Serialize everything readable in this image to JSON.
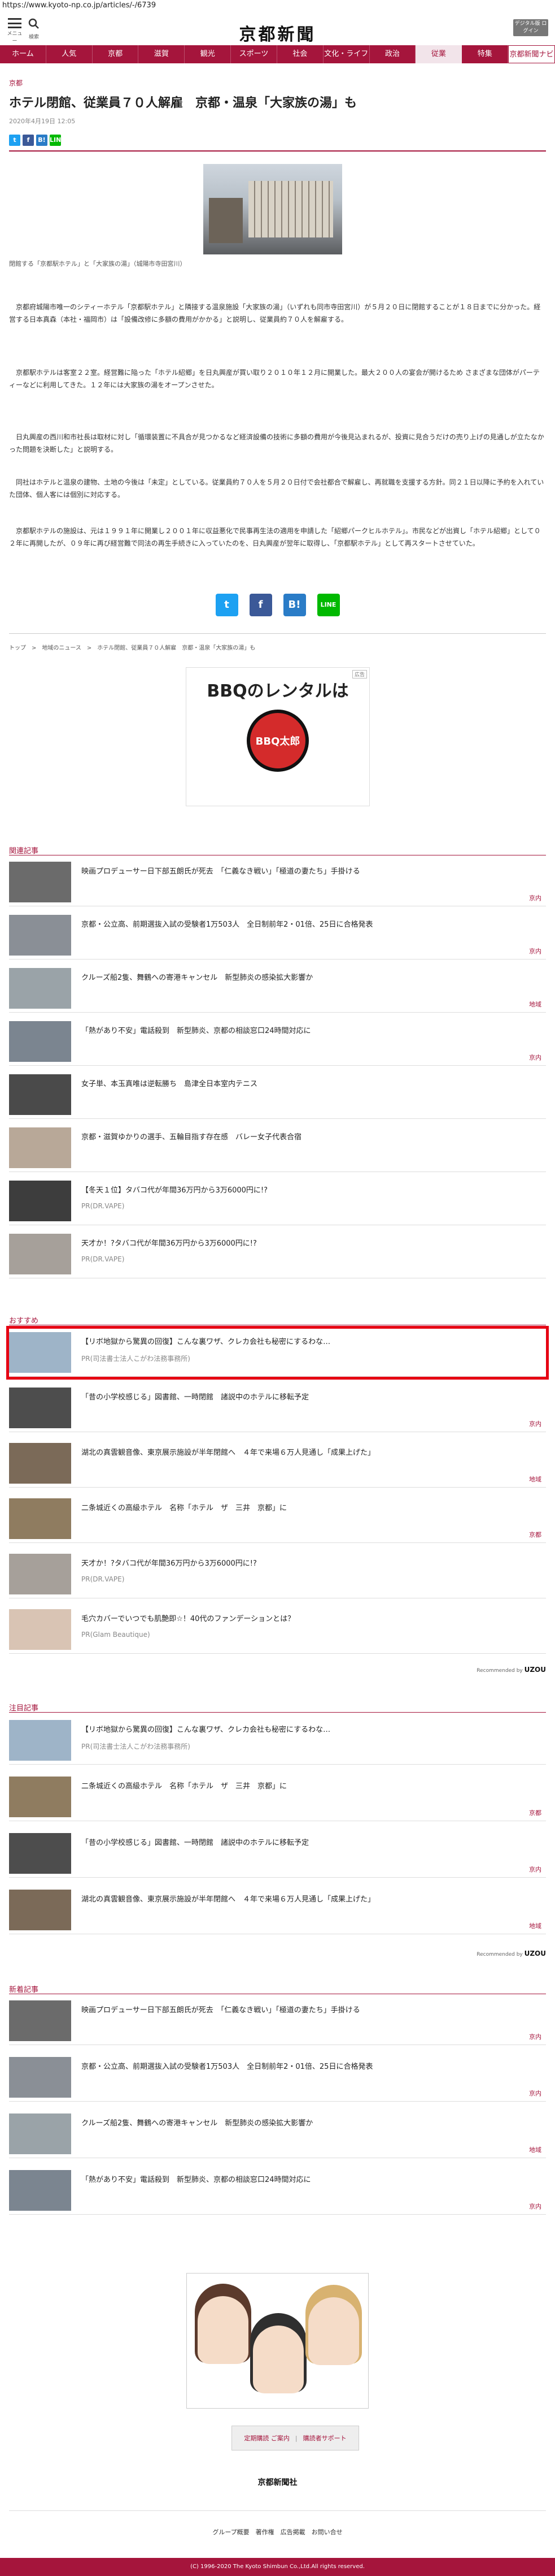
{
  "url": "https://www.kyoto-np.co.jp/articles/-/6739",
  "header": {
    "menu_label": "メニュー",
    "search_label": "検索",
    "logo": "京都新聞",
    "digital_label": "デジタル版\nログイン"
  },
  "nav": [
    "ホーム",
    "人気",
    "京都",
    "滋賀",
    "観光",
    "スポーツ",
    "社会",
    "文化・ライフ",
    "政治",
    "従業",
    "特集",
    "京都新聞ナビ"
  ],
  "article": {
    "section": "京都",
    "title": "ホテル閉館、従業員７０人解雇　京都・温泉「大家族の湯」も",
    "date": "2020年4月19日 12:05",
    "caption": "閉館する「京都駅ホテル」と「大家族の湯」（城陽市寺田宮川）",
    "paragraphs": [
      "京都府城陽市唯一のシティーホテル「京都駅ホテル」と隣接する温泉施設「大家族の湯」（いずれも同市寺田宮川）が５月２０日に閉館することが１８日までに分かった。経営する日本真森（本社・福岡市）は「設備改修に多額の費用がかかる」と説明し、従業員約７０人を解雇する。",
      "京都駅ホテルは客室２２室。経営難に陥った「ホテル紹郷」を日丸興産が買い取り２０１０年１２月に開業した。最大２００人の宴会が開けるため さまざまな団体がパーティーなどに利用してきた。１２年には大家族の湯をオープンさせた。",
      "日丸興産の西川和市社長は取材に対し「循環装置に不具合が見つかるなど経済設備の技術に多額の費用が今後見込まれるが、投資に見合うだけの売り上げの見通しが立たなかった問題を決断した」と説明する。",
      "同社はホテルと温泉の建物、土地の今後は「未定」としている。従業員約７０人を５月２０日付で会社都合で解雇し、再就職を支援する方針。同２１日以降に予約を入れていた団体、個人客には個別に対応する。",
      "京都駅ホテルの施設は、元は１９９１年に開業し２００１年に収益悪化で民事再生法の適用を申請した「紹郷パークヒルホテル」。市民などが出資し「ホテル紹郷」として０２年に再開したが、０９年に再び経営難で同法の再生手続きに入っていたのを、日丸興産が翌年に取得し、「京都駅ホテル」として再スタートさせていた。"
    ],
    "breadcrumb": "トップ　>　地域のニュース　>　ホテル閉館、従業員７０人解雇　京都・温泉「大家族の湯」も"
  },
  "share": {
    "tw": "t",
    "fb": "f",
    "hb": "B!",
    "line": "LINE"
  },
  "ad": {
    "tag": "広告",
    "title": "BBQのレンタルは",
    "brand": "BBQ太郎"
  },
  "related": {
    "title": "関連記事",
    "items": [
      {
        "text": "映画プロデューサー日下部五朗氏が死去　「仁義なき戦い」「極道の妻たち」手掛ける",
        "cat": "京内"
      },
      {
        "text": "京都・公立高、前期選抜入試の受験者1万503人　全日制前年2・01倍、25日に合格発表",
        "cat": "京内"
      },
      {
        "text": "クルーズ船2隻、舞鶴への寄港キャンセル　新型肺炎の感染拡大影響か",
        "cat": "地域"
      },
      {
        "text": "「熱があり不安」電話殺到　新型肺炎、京都の相談窓口24時間対応に",
        "cat": "京内"
      },
      {
        "text": "女子単、本玉真唯は逆転勝ち　島津全日本室内テニス",
        "cat": ""
      },
      {
        "text": "京都・滋賀ゆかりの選手、五輪目指す存在感　バレー女子代表合宿",
        "cat": ""
      },
      {
        "text": "【冬天１位】タバコ代が年間36万円から3万6000円に!?",
        "pr": "PR(DR.VAPE)",
        "cat": ""
      },
      {
        "text": "天才か！?タバコ代が年間36万円から3万6000円に!?",
        "pr": "PR(DR.VAPE)",
        "cat": ""
      }
    ]
  },
  "recommend": {
    "title": "おすすめ",
    "recommended_by": "Recommended by",
    "brand": "UZOU",
    "items": [
      {
        "text": "【リボ地獄から驚異の回復】こんな裏ワザ、クレカ会社も秘密にするわな…",
        "pr": "PR(司法書士法人こがわ法務事務所)",
        "cat": ""
      },
      {
        "text": "「昔の小学校感じる」図書館、一時閉館　諸説中のホテルに移転予定",
        "cat": "京内"
      },
      {
        "text": "湖北の真雲観音像、東京展示施設が半年閉館へ　４年で来場６万人見通し「成果上げた」",
        "cat": "地域"
      },
      {
        "text": "二条城近くの高級ホテル　名称「ホテル　ザ　三井　京都」に",
        "cat": "京都"
      },
      {
        "text": "天才か！?タバコ代が年間36万円から3万6000円に!?",
        "pr": "PR(DR.VAPE)",
        "cat": ""
      },
      {
        "text": "毛穴カバーでいつでも肌艶即☆！40代のファンデーションとは？",
        "pr": "PR(Glam Beautique)",
        "cat": ""
      }
    ]
  },
  "attention": {
    "title": "注目記事",
    "recommended_by": "Recommended by",
    "brand": "UZOU",
    "items": [
      {
        "text": "【リボ地獄から驚異の回復】こんな裏ワザ、クレカ会社も秘密にするわな…",
        "pr": "PR(司法書士法人こがわ法務事務所)",
        "cat": ""
      },
      {
        "text": "二条城近くの高級ホテル　名称「ホテル　ザ　三井　京都」に",
        "cat": "京都"
      },
      {
        "text": "「昔の小学校感じる」図書館、一時閉館　諸説中のホテルに移転予定",
        "cat": "京内"
      },
      {
        "text": "湖北の真雲観音像、東京展示施設が半年閉館へ　４年で来場６万人見通し「成果上げた」",
        "cat": "地域"
      }
    ]
  },
  "latest": {
    "title": "新着記事",
    "items": [
      {
        "text": "映画プロデューサー日下部五朗氏が死去　「仁義なき戦い」「極道の妻たち」手掛ける",
        "cat": "京内"
      },
      {
        "text": "京都・公立高、前期選抜入試の受験者1万503人　全日制前年2・01倍、25日に合格発表",
        "cat": "京内"
      },
      {
        "text": "クルーズ船2隻、舞鶴への寄港キャンセル　新型肺炎の感染拡大影響か",
        "cat": "地域"
      },
      {
        "text": "「熱があり不安」電話殺到　新型肺炎、京都の相談窓口24時間対応に",
        "cat": "京内"
      }
    ]
  },
  "buttons": {
    "b1": "定期購読 ご案内",
    "b2": "購読者サポート"
  },
  "footer": {
    "logo": "京都新聞社",
    "links": "グループ概要　著作権　広告掲載　お問い合せ",
    "copyright": "(C) 1996-2020 The Kyoto Shimbun Co.,Ltd.All rights reserved."
  },
  "colors": {
    "brand": "#a5153c",
    "highlight": "#e60012"
  }
}
